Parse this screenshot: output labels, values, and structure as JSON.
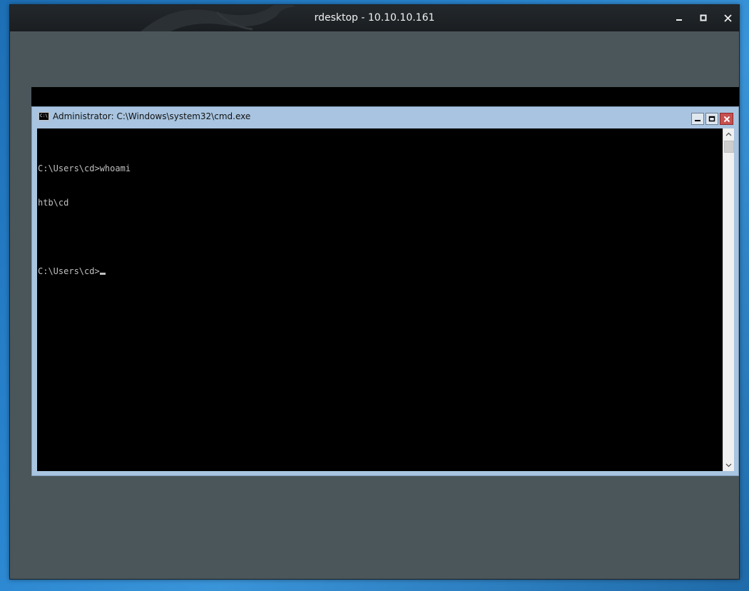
{
  "outer_window": {
    "title": "rdesktop - 10.10.10.161",
    "buttons": {
      "minimize_icon": "minimize-icon",
      "maximize_icon": "maximize-icon",
      "close_icon": "close-icon"
    }
  },
  "cmd_window": {
    "title": "Administrator: C:\\Windows\\system32\\cmd.exe",
    "icon_text": "C:\\",
    "console_lines": [
      "C:\\Users\\cd>whoami",
      "htb\\cd",
      "",
      "C:\\Users\\cd>"
    ]
  },
  "colors": {
    "desktop_blue": "#2a86d0",
    "remote_bg": "#4b565b",
    "cmd_frame": "#a8c4e0",
    "console_bg": "#000000",
    "console_fg": "#c0c0c0",
    "close_red": "#c75050"
  }
}
